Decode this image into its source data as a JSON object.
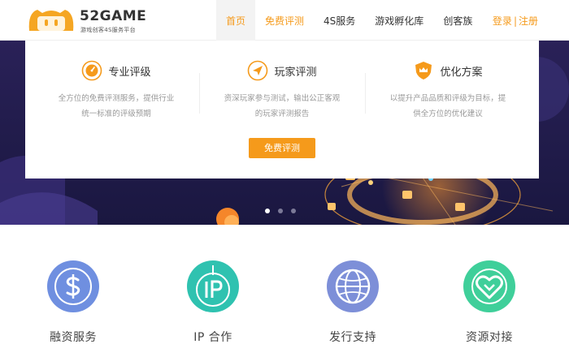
{
  "header": {
    "logo_text": "52GAME",
    "logo_sub": "游戏创客4S服务平台",
    "nav": [
      {
        "label": "首页"
      },
      {
        "label": "免费评测"
      },
      {
        "label": "4S服务"
      },
      {
        "label": "游戏孵化库"
      },
      {
        "label": "创客族"
      }
    ],
    "login": "登录",
    "separator": "|",
    "register": "注册"
  },
  "features": [
    {
      "title": "专业评级",
      "icon": "gauge-icon",
      "desc": "全方位的免费评测服务，提供行业统一标准的评级预期"
    },
    {
      "title": "玩家评测",
      "icon": "paper-plane-icon",
      "desc": "资深玩家参与测试，输出公正客观的玩家评测报告"
    },
    {
      "title": "优化方案",
      "icon": "crown-shield-icon",
      "desc": "以提升产品品质和评级为目标，提供全方位的优化建议"
    }
  ],
  "cta_label": "免费评测",
  "carousel": {
    "count": 3,
    "active": 0
  },
  "services": [
    {
      "label": "融资服务",
      "icon": "dollar-icon",
      "color": "#6f8fe0"
    },
    {
      "label": "IP 合作",
      "icon": "ip-icon",
      "color": "#2fc2b0"
    },
    {
      "label": "发行支持",
      "icon": "globe-icon",
      "color": "#7d8fd8"
    },
    {
      "label": "资源对接",
      "icon": "heart-link-icon",
      "color": "#3fcf9a"
    }
  ],
  "colors": {
    "accent": "#f59a1b",
    "banner": "#231d4e"
  }
}
